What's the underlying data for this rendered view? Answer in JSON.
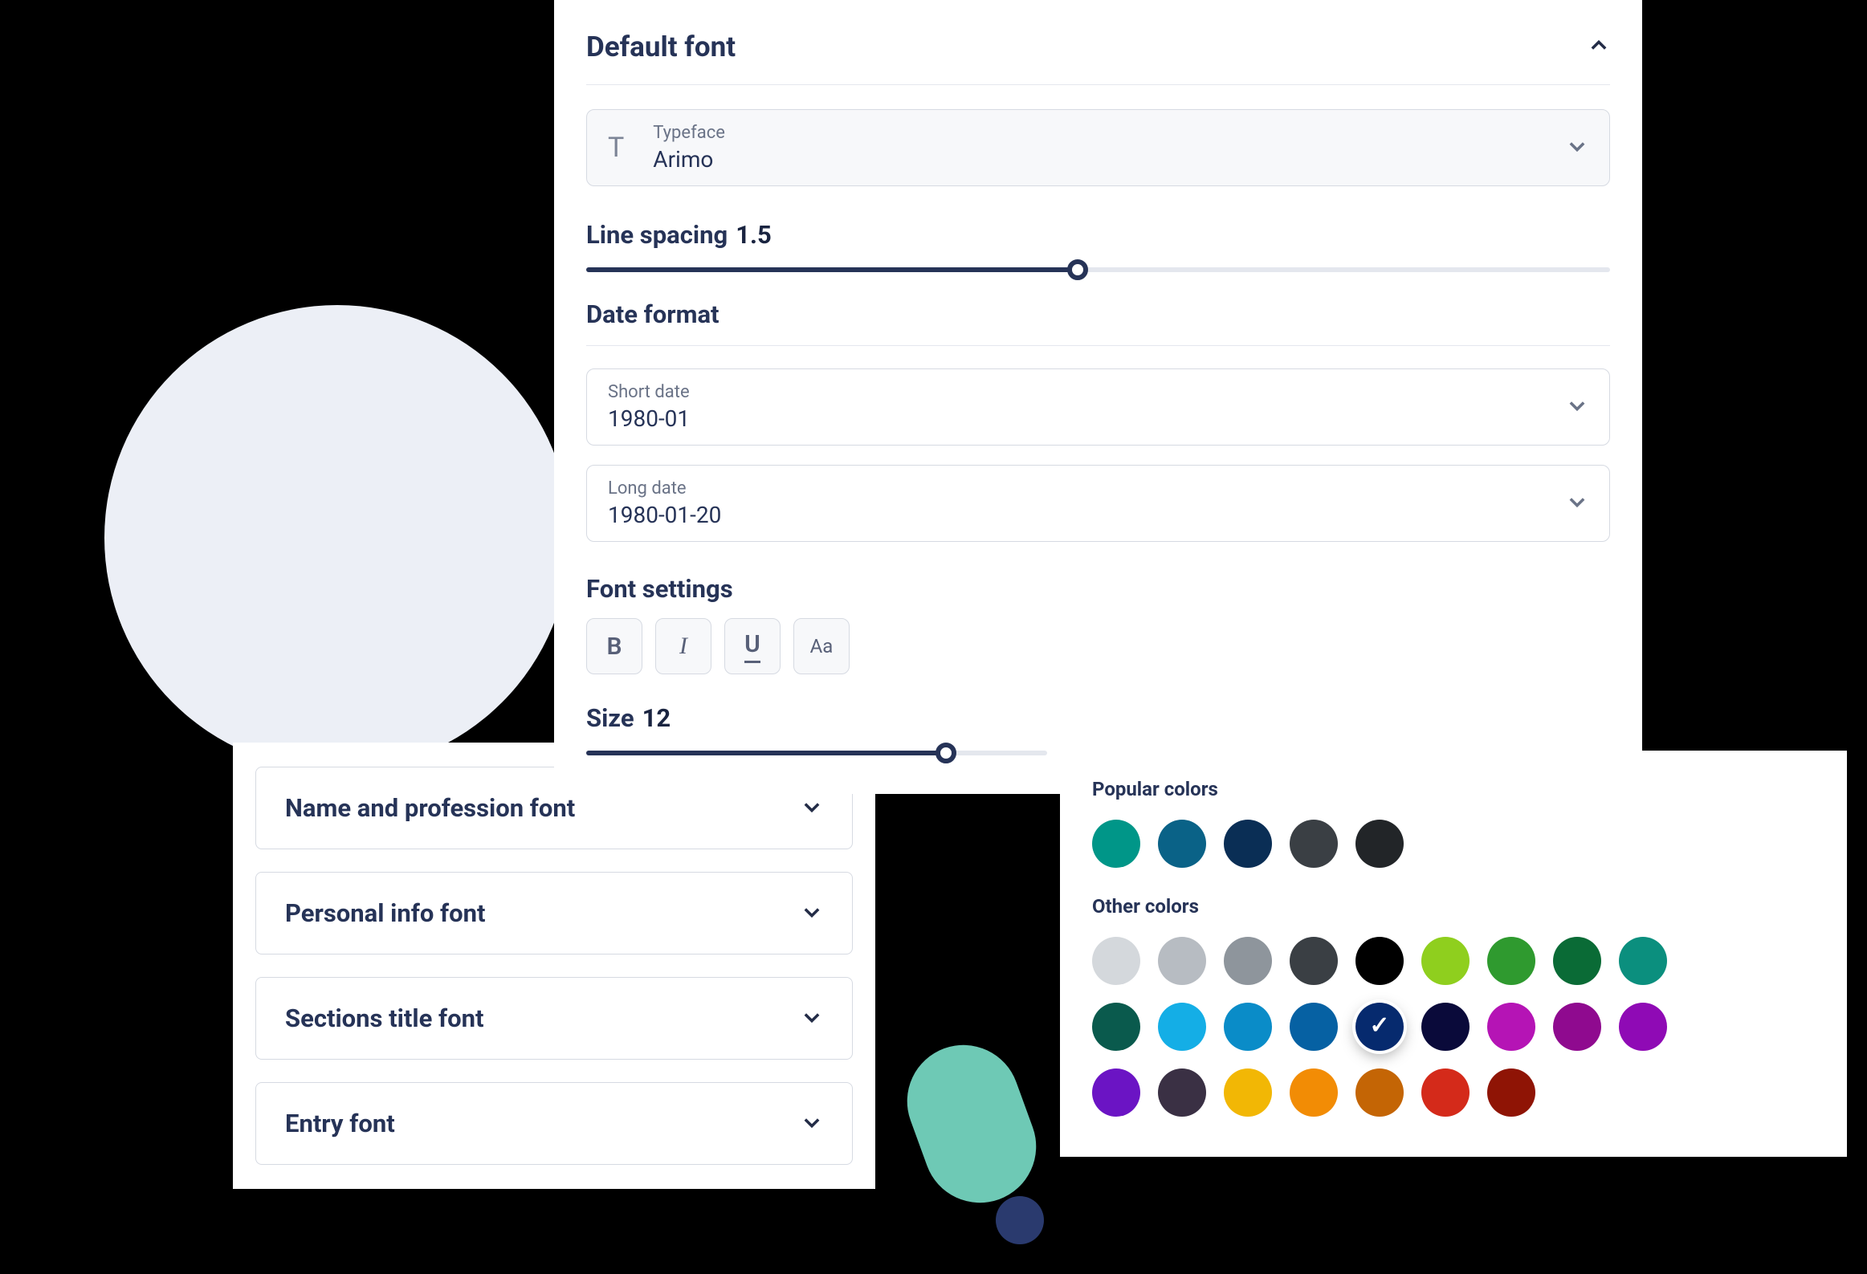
{
  "leftPanel": {
    "items": [
      {
        "label": "Name and profession font"
      },
      {
        "label": "Personal info font"
      },
      {
        "label": "Sections title font"
      },
      {
        "label": "Entry font"
      }
    ]
  },
  "mainPanel": {
    "title": "Default font",
    "typeface": {
      "label": "Typeface",
      "value": "Arimo"
    },
    "lineSpacing": {
      "label": "Line spacing",
      "value": "1.5",
      "percent": 48
    },
    "dateFormat": {
      "title": "Date format",
      "short": {
        "label": "Short date",
        "value": "1980-01"
      },
      "long": {
        "label": "Long date",
        "value": "1980-01-20"
      }
    },
    "fontSettings": {
      "title": "Font settings",
      "buttons": {
        "bold": "B",
        "italic": "I",
        "underline": "U",
        "case": "Aa"
      }
    },
    "size": {
      "label": "Size",
      "value": "12",
      "percent": 78
    }
  },
  "colorPicker": {
    "popularTitle": "Popular colors",
    "otherTitle": "Other colors",
    "popular": [
      "#009688",
      "#0a6287",
      "#0a2e55",
      "#3a3f44",
      "#222528"
    ],
    "other": [
      "#d4d8dc",
      "#b7bcc2",
      "#8e959c",
      "#3a3f44",
      "#000000",
      "#8fcf1e",
      "#2f9a2f",
      "#0a6b36",
      "#0b8f7e",
      "#0a5a4d",
      "#14aee6",
      "#0a8cc8",
      "#0661a3",
      "#062a6e",
      "#0a0a3a",
      "#b514b5",
      "#8f0a8f",
      "#8f0ab5",
      "#6b14c4",
      "#3a3044",
      "#f2b705",
      "#f28c05",
      "#c46505",
      "#d42a1a",
      "#8f1405"
    ],
    "selected": "#062a6e"
  }
}
